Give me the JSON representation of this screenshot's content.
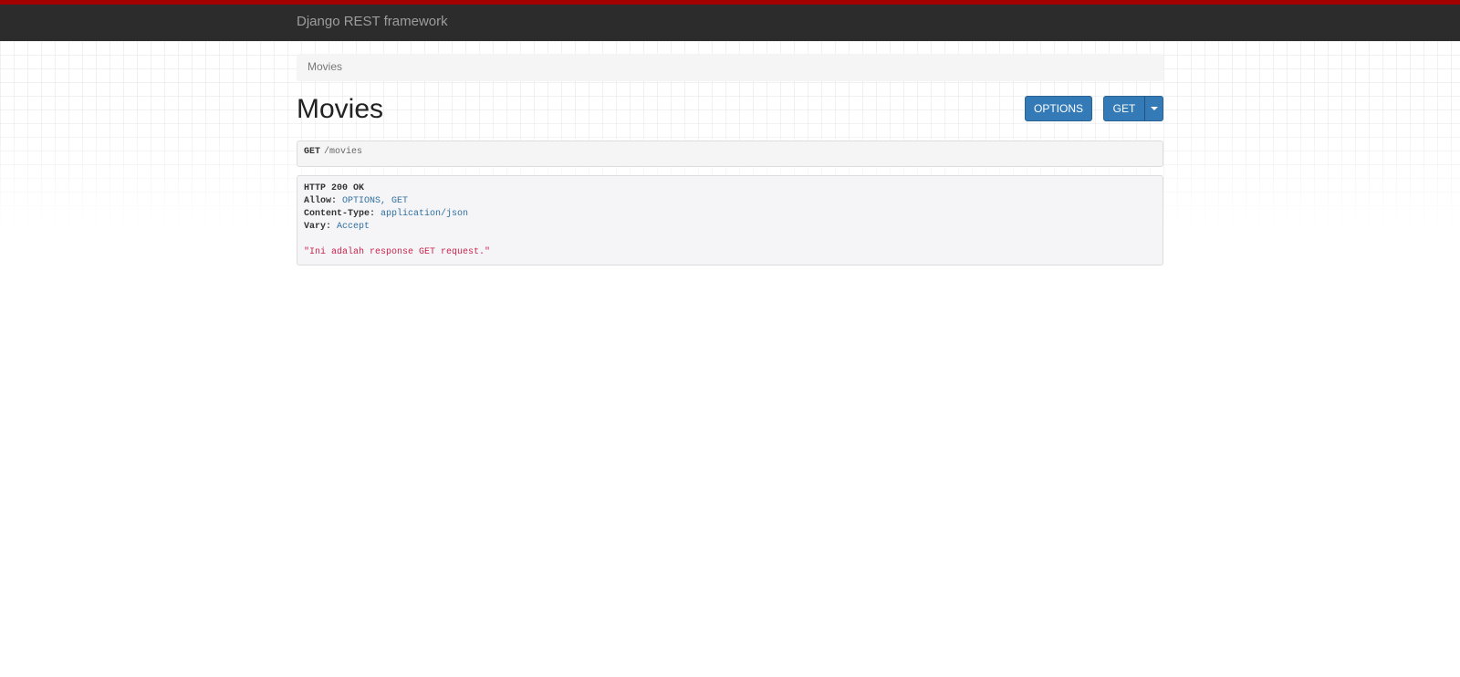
{
  "navbar": {
    "brand": "Django REST framework"
  },
  "breadcrumb": {
    "items": [
      "Movies"
    ]
  },
  "page": {
    "title": "Movies"
  },
  "buttons": {
    "options_label": "OPTIONS",
    "get_label": "GET"
  },
  "request": {
    "method": "GET",
    "path": "/movies"
  },
  "response": {
    "status_line": "HTTP 200 OK",
    "headers": [
      {
        "name": "Allow:",
        "value": "OPTIONS, GET"
      },
      {
        "name": "Content-Type:",
        "value": "application/json"
      },
      {
        "name": "Vary:",
        "value": "Accept"
      }
    ],
    "body": "\"Ini adalah response GET request.\""
  },
  "colors": {
    "accent_bar": "#a30000",
    "navbar_bg": "#2c2c2c",
    "button_primary": "#337ab7",
    "header_value": "#2f6f9f",
    "body_string": "#c7254e"
  }
}
